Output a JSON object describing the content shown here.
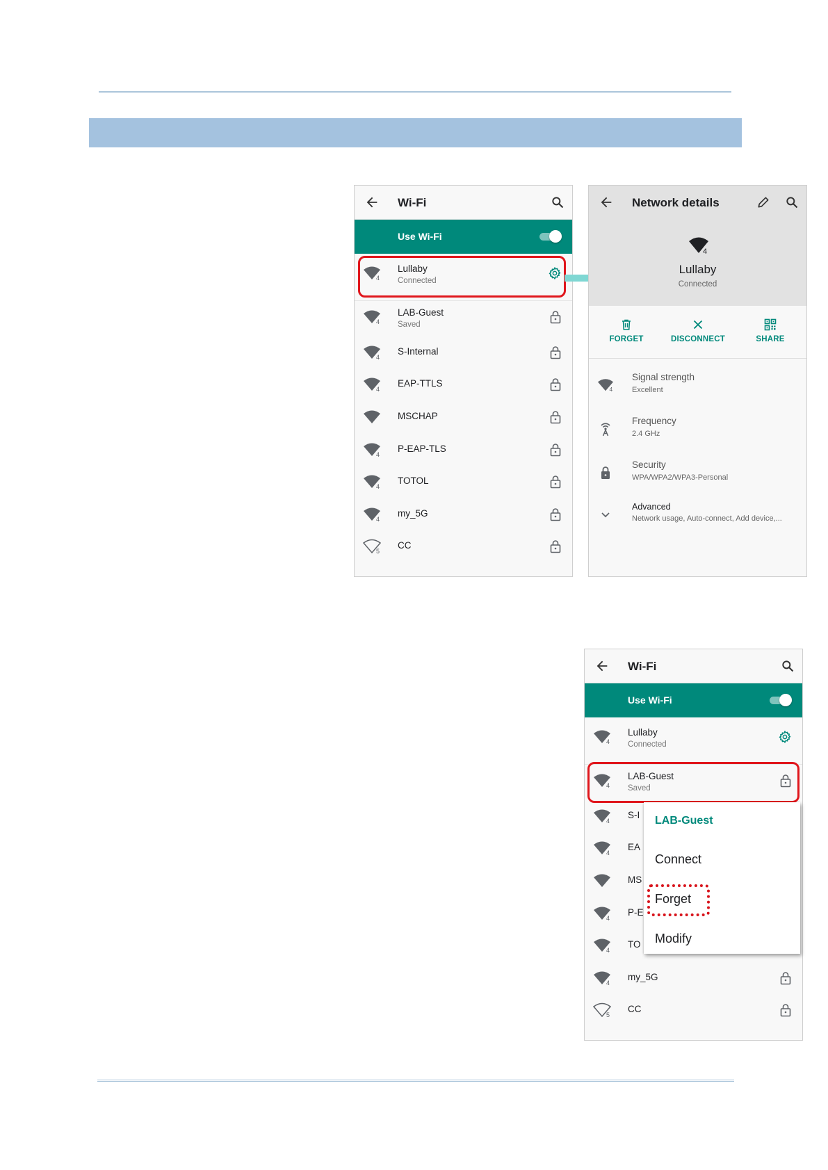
{
  "panel1": {
    "title": "Wi-Fi",
    "use_wifi": "Use Wi-Fi",
    "networks": [
      {
        "name": "Lullaby",
        "status": "Connected",
        "badge": "4",
        "icon": "gear-icon"
      },
      {
        "name": "LAB-Guest",
        "status": "Saved",
        "badge": "4",
        "icon": "lock-icon"
      },
      {
        "name": "S-Internal",
        "status": "",
        "badge": "4",
        "icon": "lock-icon"
      },
      {
        "name": "EAP-TTLS",
        "status": "",
        "badge": "4",
        "icon": "lock-icon"
      },
      {
        "name": "MSCHAP",
        "status": "",
        "badge": "",
        "icon": "lock-icon"
      },
      {
        "name": "P-EAP-TLS",
        "status": "",
        "badge": "4",
        "icon": "lock-icon"
      },
      {
        "name": "TOTOL",
        "status": "",
        "badge": "4",
        "icon": "lock-icon"
      },
      {
        "name": "my_5G",
        "status": "",
        "badge": "4",
        "icon": "lock-icon"
      },
      {
        "name": "CC",
        "status": "",
        "badge": "5",
        "icon": "lock-icon"
      }
    ]
  },
  "panel2": {
    "title": "Network details",
    "network_name": "Lullaby",
    "network_status": "Connected",
    "badge": "4",
    "actions": {
      "forget": "FORGET",
      "disconnect": "DISCONNECT",
      "share": "SHARE"
    },
    "details": [
      {
        "title": "Signal strength",
        "value": "Excellent"
      },
      {
        "title": "Frequency",
        "value": "2.4 GHz"
      },
      {
        "title": "Security",
        "value": "WPA/WPA2/WPA3-Personal"
      },
      {
        "title": "Advanced",
        "value": "Network usage, Auto-connect, Add device,..."
      }
    ]
  },
  "panel3": {
    "title": "Wi-Fi",
    "use_wifi": "Use Wi-Fi",
    "networks": [
      {
        "name": "Lullaby",
        "status": "Connected",
        "badge": "4"
      },
      {
        "name": "LAB-Guest",
        "status": "Saved",
        "badge": "4"
      },
      {
        "name": "S-I",
        "badge": "4"
      },
      {
        "name": "EA",
        "badge": "4"
      },
      {
        "name": "MS",
        "badge": ""
      },
      {
        "name": "P-E",
        "badge": "4"
      },
      {
        "name": "TO",
        "badge": "4"
      },
      {
        "name": "my_5G",
        "badge": "4"
      },
      {
        "name": "CC",
        "badge": "5"
      }
    ],
    "popup": {
      "title": "LAB-Guest",
      "options": [
        "Connect",
        "Forget",
        "Modify"
      ]
    }
  },
  "colors": {
    "accent": "#00897b",
    "highlight": "#e0161c",
    "banner": "#a4c2df"
  }
}
